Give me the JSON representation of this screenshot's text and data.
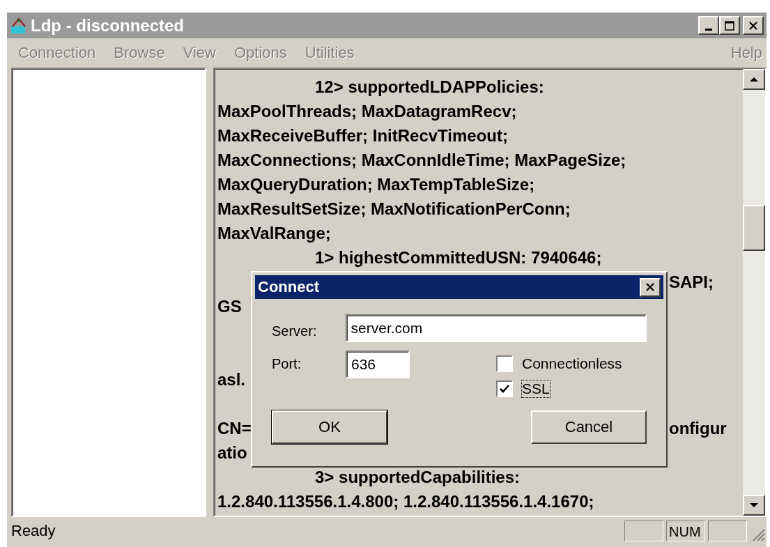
{
  "window": {
    "title": "Ldp - disconnected"
  },
  "menu": [
    {
      "label": "Connection",
      "disabled": true
    },
    {
      "label": "Browse",
      "disabled": true
    },
    {
      "label": "View",
      "disabled": true
    },
    {
      "label": "Options",
      "disabled": true
    },
    {
      "label": "Utilities",
      "disabled": true
    },
    {
      "label": "Help",
      "disabled": true
    }
  ],
  "output_lines": [
    {
      "kind": "indented",
      "text": "12> supportedLDAPPolicies:"
    },
    {
      "kind": "text",
      "text": "MaxPoolThreads; MaxDatagramRecv;"
    },
    {
      "kind": "text",
      "text": "MaxReceiveBuffer; InitRecvTimeout;"
    },
    {
      "kind": "text",
      "text": "MaxConnections; MaxConnIdleTime; MaxPageSize;"
    },
    {
      "kind": "text",
      "text": "MaxQueryDuration; MaxTempTableSize;"
    },
    {
      "kind": "text",
      "text": "MaxResultSetSize; MaxNotificationPerConn;"
    },
    {
      "kind": "text",
      "text": "MaxValRange;"
    },
    {
      "kind": "indented",
      "text": "1> highestCommittedUSN: 7940646;"
    },
    {
      "kind": "split",
      "right": "SAPI;"
    },
    {
      "kind": "split",
      "left": "GS"
    },
    {
      "kind": "blank"
    },
    {
      "kind": "blank"
    },
    {
      "kind": "split",
      "left": "asl."
    },
    {
      "kind": "blank"
    },
    {
      "kind": "split",
      "left": "CN=",
      "right": "onfigur"
    },
    {
      "kind": "split",
      "left": "atio"
    },
    {
      "kind": "indented",
      "text": "3> supportedCapabilities:"
    },
    {
      "kind": "text",
      "text": "1.2.840.113556.1.4.800; 1.2.840.113556.1.4.1670;"
    }
  ],
  "status_bar": {
    "text": "Ready",
    "panels": [
      {
        "kind": "empty"
      },
      {
        "kind": "text",
        "text": "NUM"
      },
      {
        "kind": "empty"
      }
    ]
  },
  "dialog": {
    "title": "Connect",
    "server_label": "Server:",
    "server_value": "server.com",
    "port_label": "Port:",
    "port_value": "636",
    "options": [
      {
        "label": "Connectionless",
        "checked": false,
        "focused": false
      },
      {
        "label": "SSL",
        "checked": true,
        "focused": true
      }
    ],
    "buttons": [
      {
        "label": "OK",
        "default": true
      },
      {
        "label": "Cancel",
        "default": false
      }
    ]
  }
}
